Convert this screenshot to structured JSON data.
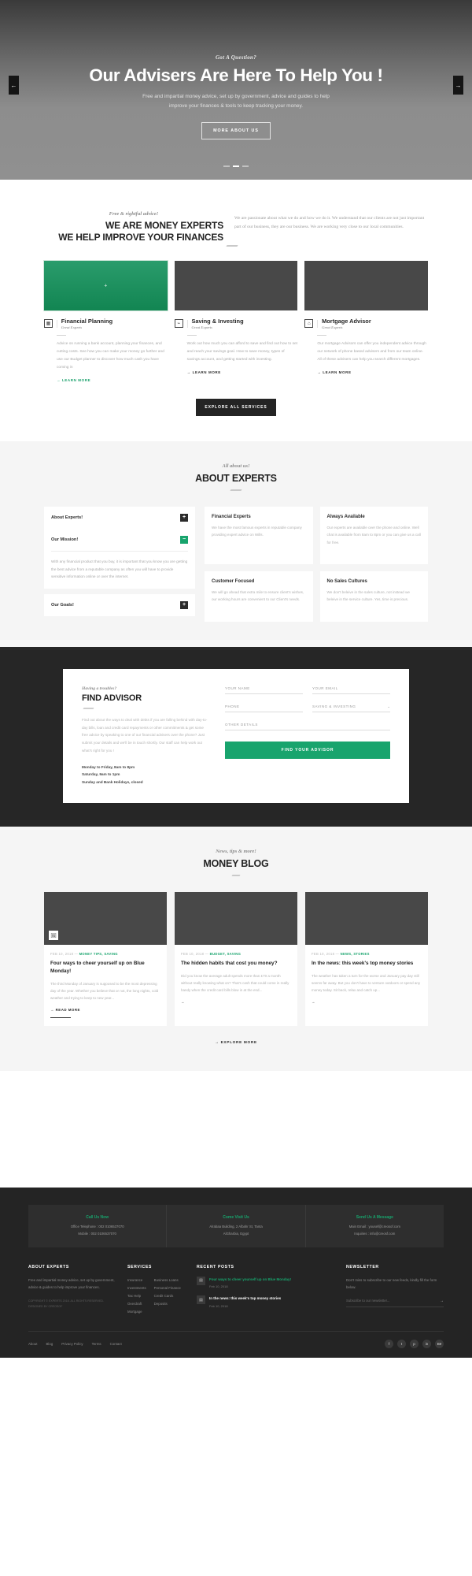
{
  "hero": {
    "kicker": "Got A Question?",
    "title": "Our Advisers Are Here To Help You !",
    "sub_line1": "Free and impartial money advice, set up by government, advice and guides to help",
    "sub_line2": "improve your finances & tools to keep tracking your money.",
    "button": "MORE ABOUT US",
    "prev_icon": "←",
    "next_icon": "→"
  },
  "experts": {
    "kicker": "Free & rightful advice!",
    "title_line1": "WE ARE MONEY EXPERTS",
    "title_line2": "WE HELP IMPROVE YOUR FINANCES",
    "paragraph": "We are passionate about what we do and how we do it. We understand that our clients are not just important part of our business, they are our business. We are working very close to our local communities.",
    "explore_button": "EXPLORE ALL SERVICES",
    "cards": [
      {
        "title": "Financial Planning",
        "subtitle": "Great Experts",
        "icon": "calculator-icon",
        "glyph": "▦",
        "text": "Advice on running a bank account, planning your finances, and cutting costs. See how you can make your money go further and use our Budget planner to discover how much cash you have coming in",
        "link": "→ LEARN MORE",
        "featured": true,
        "plus": "+"
      },
      {
        "title": "Saving & Investing",
        "subtitle": "Great Experts",
        "icon": "chart-up-icon",
        "glyph": "📈",
        "text": "Work out how much you can afford to save and find out how to set and reach your savings goal. How to save money, types of savings account, and getting started with investing.",
        "link": "→ LEARN MORE",
        "featured": false
      },
      {
        "title": "Mortgage Advisor",
        "subtitle": "Great Experts",
        "icon": "house-icon",
        "glyph": "🏠",
        "text": "Our mortgage Advisors can offer you independent advice through our network of phone based advisers and from our team online. All of these advisers can help you search different mortgages.",
        "link": "→ LEARN MORE",
        "featured": false
      }
    ]
  },
  "about": {
    "kicker": "All about us!",
    "title": "ABOUT EXPERTS",
    "accordion": [
      {
        "title": "About Experts!",
        "open": false,
        "toggle": "+",
        "body": ""
      },
      {
        "title": "Our Mission!",
        "open": true,
        "toggle": "−",
        "body": "With any financial product that you buy, it is important that you know you are getting the best advice from a reputable company as often you will have to provide sensitive information online or over the internet."
      },
      {
        "title": "Our Goals!",
        "open": false,
        "toggle": "+",
        "body": ""
      }
    ],
    "features": [
      {
        "title": "Financial Experts",
        "text": "We have the most famous experts in reputable company providing expert advice on Wills."
      },
      {
        "title": "Always Available",
        "text": "Our experts are available over the phone and online. Well chat is available from 8am to 8pm or you can give us a call for free."
      },
      {
        "title": "Customer Focused",
        "text": "We will go ahead that extra mile to ensure client's wishes, our working hours are convenient to our Client's needs."
      },
      {
        "title": "No Sales Cultures",
        "text": "We don't beleive in the sales culture, not instead we beleive in the service culture. Yes, time is precious."
      }
    ]
  },
  "finder": {
    "kicker": "Having a troubles?",
    "title": "FIND ADVISOR",
    "paragraph": "Find out about the ways to deal with debts if you are falling behind with day-to-day bills, loan and credit card repayments or other commitments & get some free advice by speaking to one of our financial advisers over the phone? Just submit your details and we'll be in touch shortly. Our staff can help work out what's right for you !",
    "hours_1": "Monday to Friday, 8am to 8pm",
    "hours_2": "Saturday, 9am to 1pm",
    "hours_3": "Sunday and Bank Holidays, closed",
    "fields": {
      "name": "YOUR NAME",
      "email": "YOUR EMAIL",
      "phone": "PHONE",
      "service": "SAVING & INVESTING",
      "service_chevron": "⌄",
      "details": "OTHER DETAILS"
    },
    "submit": "FIND YOUR ADVISOR"
  },
  "blog": {
    "kicker": "News, tips & more!",
    "title": "MONEY BLOG",
    "explore": "→ EXPLORE MORE",
    "posts": [
      {
        "date": "FEB 10, 2018",
        "category": "MONEY TIPS, SAVING",
        "title": "Four ways to cheer yourself up on Blue Monday!",
        "excerpt": "The third Monday of January is supposed to be the most depressing day of the year. Whether you believe that or not, the long nights, cold weather and trying to keep to new year...",
        "link": "→ READ MORE",
        "badge": "🖼",
        "has_badge": true,
        "has_bar": true
      },
      {
        "date": "FEB 10, 2018",
        "category": "BUDGET, SAVING",
        "title": "The hidden habits that cost you money?",
        "excerpt": "Did you know the average adult spends more than £70 a month without really knowing what on? That's cash that could come in really handy when the credit card bills blow in at the end...",
        "link": "→",
        "has_badge": false,
        "has_bar": false
      },
      {
        "date": "FEB 10, 2018",
        "category": "NEWS, STORIES",
        "title": "In the news: this week's top money stories",
        "excerpt": "The weather has taken a turn for the worse and January pay day still seems far away. But you don't have to venture outdoors or spend any money today. Sit back, relax and catch up...",
        "link": "→",
        "has_badge": false,
        "has_bar": false
      }
    ]
  },
  "footer": {
    "contact": [
      {
        "title": "Call Us Now",
        "lines": [
          "Office Telephone : 002 0106537070",
          "Mobile : 002 0106537070"
        ]
      },
      {
        "title": "Come Visit Us",
        "lines": [
          "Alrabaa Building, 2 Albahr St, Tanta",
          "AlGharbia, Egypt"
        ]
      },
      {
        "title": "Send Us A Message",
        "lines": [
          "Main Email : yousef@creosof.com",
          "Inquiries : info@creosf.com"
        ]
      }
    ],
    "about": {
      "heading": "ABOUT EXPERTS",
      "text": "Free and impartial money advice, set up by government, advice & guides to help improve your finances.",
      "small": "COPYRIGHT © EXPERTS 2018.  ALL RIGHTS RESERVED. DESIGNED BY CREOSOF"
    },
    "services": {
      "heading": "SERVICES",
      "items": [
        "Insurance",
        "Investments",
        "Tax Help",
        "Overdraft",
        "Mortgage"
      ]
    },
    "services2": {
      "items": [
        "Business Loans",
        "Personal Finance",
        "Credit Cards",
        "Deposits"
      ]
    },
    "recent": {
      "heading": "RECENT POSTS",
      "posts": [
        {
          "title": "Four ways to cheer yourself up on Blue Monday!",
          "date": "Feb 10, 2018",
          "green": true,
          "icon": "document-icon",
          "glyph": "▤"
        },
        {
          "title": "In the news: this week's top money stories",
          "date": "Feb 10, 2018",
          "green": false,
          "icon": "document-icon",
          "glyph": "▤"
        }
      ]
    },
    "newsletter": {
      "heading": "NEWSLETTER",
      "text": "Don't miss to subscribe to our new feeds, kindly fill the form below.",
      "placeholder": "Subscribe to our newsletter...",
      "submit": "→"
    },
    "bottom_nav": [
      "About",
      "Blog",
      "Privacy Policy",
      "Terms",
      "Contact"
    ],
    "social": [
      {
        "name": "facebook-icon",
        "glyph": "f"
      },
      {
        "name": "twitter-icon",
        "glyph": "t"
      },
      {
        "name": "pinterest-icon",
        "glyph": "p"
      },
      {
        "name": "linkedin-icon",
        "glyph": "in"
      },
      {
        "name": "behance-icon",
        "glyph": "Bē"
      }
    ]
  }
}
